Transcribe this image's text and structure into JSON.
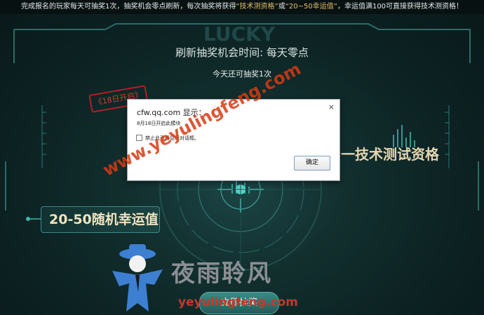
{
  "announcement": {
    "part1": "完成报名的玩家每天可抽奖1次，抽奖机会零点刷新，每次抽奖将获得",
    "quote1": "“技术测资格”",
    "or": "或",
    "quote2": "“20~50幸运值”",
    "part2": "，幸运值满100可直接获得技术测资格！"
  },
  "header": {
    "refresh_text": "刷新抽奖机会时间: 每天零点",
    "remaining_text": "今天还可抽奖1次"
  },
  "stamp_text": "《18日开启》",
  "prizes": {
    "tech_label": "一技术测试资格",
    "lucky_label": "20-50随机幸运值"
  },
  "draw_button_label": "立即抽奖",
  "dialog": {
    "title": "cfw.qq.com 显示：",
    "message": "8月18日开启此模块",
    "checkbox_label": "禁止此页再显示对话框。",
    "ok_label": "确定",
    "close_glyph": "×"
  },
  "watermark": {
    "diagonal_url": "www.yeyulingfeng.com",
    "logo_cn": "夜雨聆风",
    "logo_url": "yeyulingfeng.com"
  },
  "colors": {
    "accent_gold": "#e3c06a",
    "stamp_red": "#d33a2f",
    "watermark_orange": "#d83a12",
    "hud_teal": "#3fb6ac"
  },
  "icons": {
    "close": "close-icon",
    "crosshair": "crosshair-icon",
    "mascot": "mascot-logo"
  }
}
